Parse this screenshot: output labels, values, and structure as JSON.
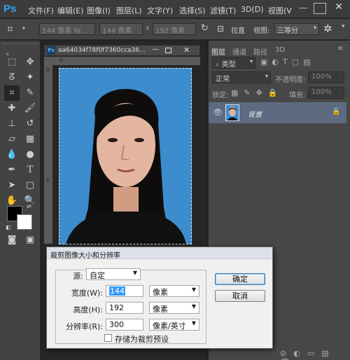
{
  "app": {
    "logo": "Ps",
    "menu": [
      "文件(F)",
      "编辑(E)",
      "图像(I)",
      "图层(L)",
      "文字(Y)",
      "选择(S)",
      "滤镜(T)",
      "3D(D)",
      "视图(V"
    ]
  },
  "options": {
    "preset": "144 像素 W...",
    "width": "144 像素",
    "sep": "x",
    "height": "192 像素",
    "straighten": "拉直",
    "view_label": "视图:",
    "view_value": "三等分"
  },
  "document": {
    "tab_label": "aa64034f78f0f7360cca36...",
    "ruler_marks": [
      "0",
      "1"
    ]
  },
  "panel": {
    "tabs": [
      "图层",
      "通道",
      "路径",
      "3D"
    ],
    "kind": "类型",
    "blend": "正常",
    "opacity_label": "不透明度:",
    "opacity_value": "100%",
    "lock_label": "锁定:",
    "fill_label": "填充:",
    "fill_value": "100%",
    "layer_name": "背景"
  },
  "dialog": {
    "title": "裁剪图像大小和分辨率",
    "source_label": "源:",
    "source_value": "自定",
    "width_label": "宽度(W):",
    "width_value": "144",
    "width_unit": "像素",
    "height_label": "高度(H):",
    "height_value": "192",
    "height_unit": "像素",
    "res_label": "分辨率(R):",
    "res_value": "300",
    "res_unit": "像素/英寸",
    "save_preset": "存储为裁剪预设",
    "ok": "确定",
    "cancel": "取消"
  },
  "colors": {
    "accent": "#2fa3f7",
    "photo_bg": "#3d8ccd",
    "layer_selected": "#5d6b82"
  }
}
